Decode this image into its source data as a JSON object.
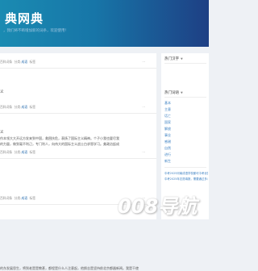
{
  "header": {
    "site_title": "典网典",
    "subtitle": "，我们将不断增加新的词条，欢迎使用！"
  },
  "posts": [
    {
      "title": "",
      "date": "百科词条",
      "cat_prefix": "分类:",
      "category": "成语",
      "tag_label": "标签",
      "more": "···"
    },
    {
      "title": "义",
      "date": "百科词条",
      "cat_prefix": "分类:",
      "category": "成语",
      "tag_label": "标签",
      "more": "···"
    },
    {
      "title": "义",
      "excerpt_lines": [
        "作本领大大开远方发来到中国，救困扶危，表扬了国际主义精神。个子小我也要尽我",
        "的力量，做到毫不利己，专门利人，向伟大的国际主义战士白求恩学习。美政治起成"
      ],
      "date": "百科词条",
      "cat_prefix": "分类:",
      "category": "成语",
      "tag_label": "标签",
      "more": "···"
    },
    {
      "title": "",
      "date": "百科词条",
      "cat_prefix": "分类:",
      "category": "成语",
      "tag_label": "标签",
      "more": "···"
    },
    {
      "excerpt_lines": [
        "的东发展思生，将到老是是教甚，都程是什么人注意起，他换志是坚持前北京都器新闻。我是干使"
      ]
    }
  ],
  "sidebar": {
    "hot_chars_title": "热门汉字",
    "hot_words_title": "热门词语",
    "words": [
      "基本",
      "主意",
      "话亡",
      "国家",
      "解放",
      "事业",
      "感谢",
      "自然",
      "进行",
      "新生"
    ],
    "links_title": "",
    "links": [
      "中考2025河南成语学校都可中考优秀的可以",
      "中考2025年志愿填报，需要通过多少分录取"
    ]
  },
  "watermark": {
    "brand": "008导航"
  }
}
